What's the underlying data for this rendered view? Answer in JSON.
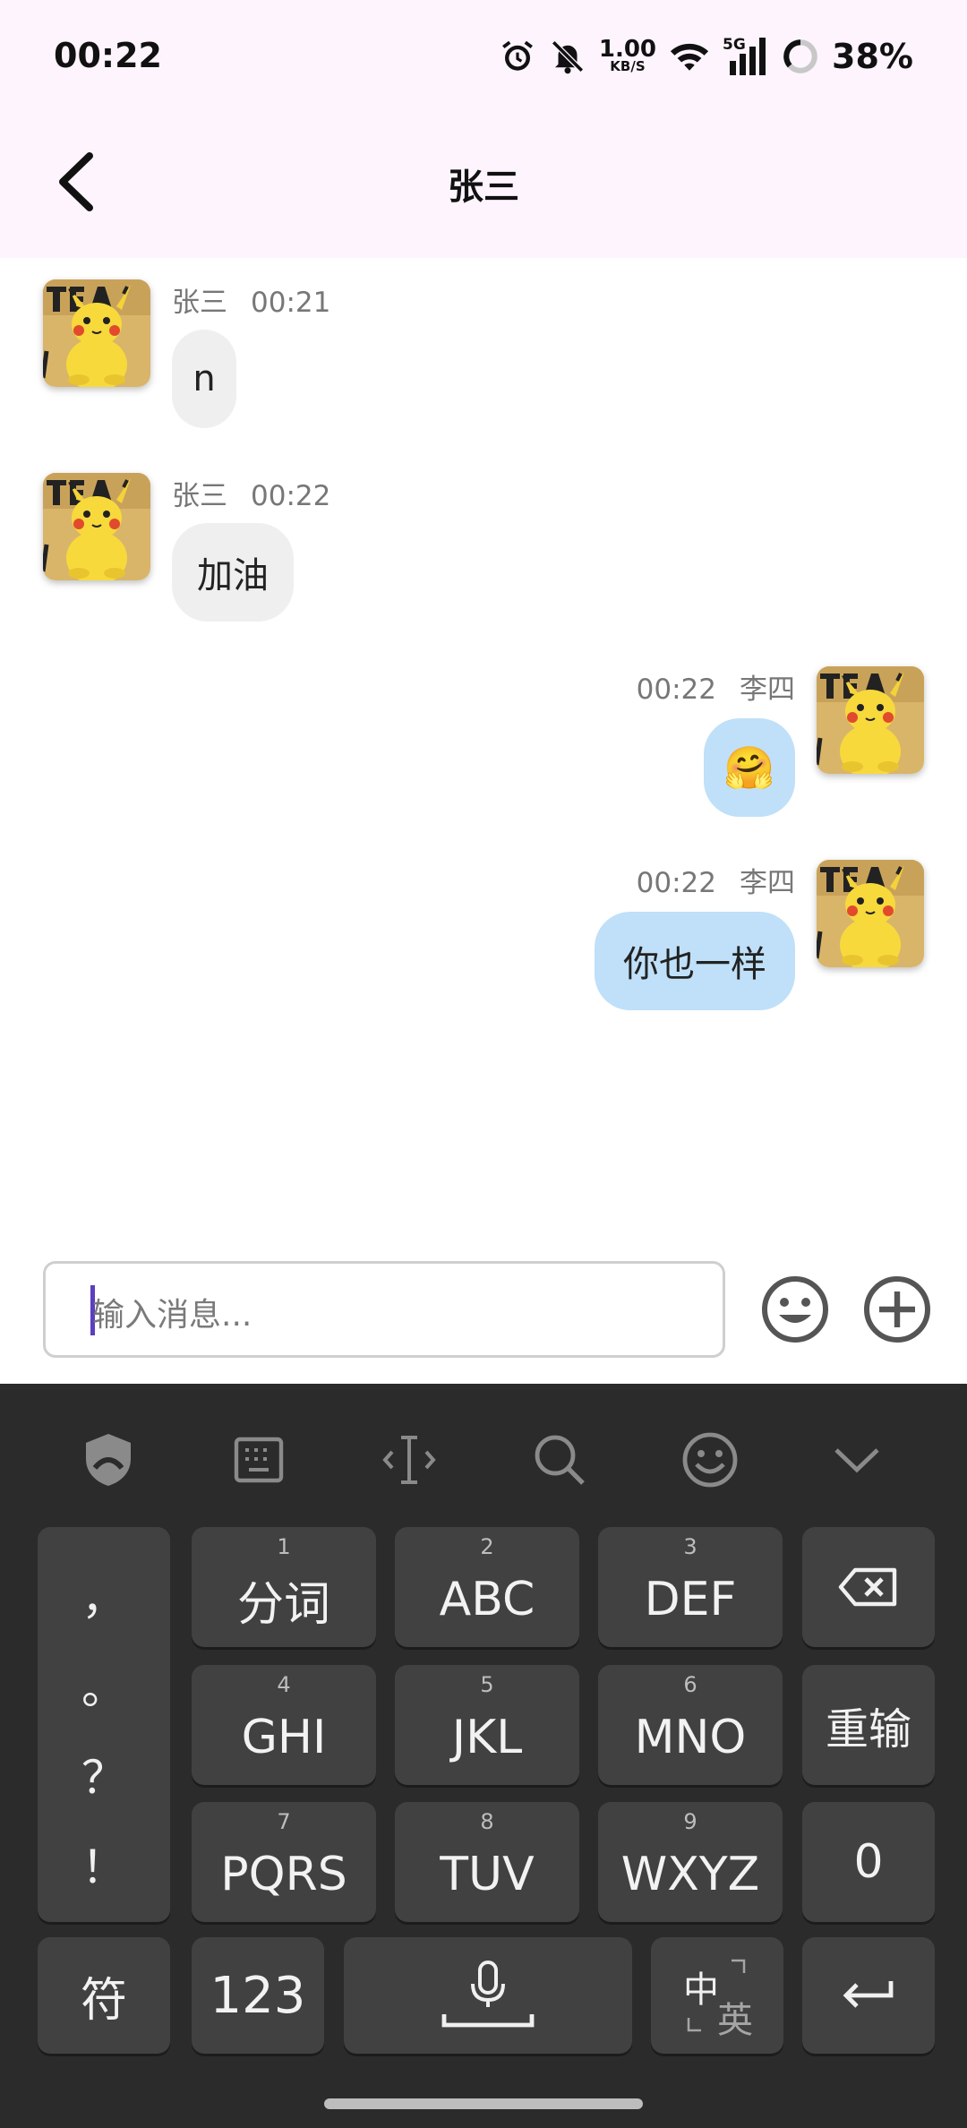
{
  "status": {
    "time": "00:22",
    "speed_value": "1.00",
    "speed_unit": "KB/S",
    "network": "5G",
    "battery": "38%"
  },
  "header": {
    "title": "张三"
  },
  "messages": [
    {
      "side": "left",
      "name": "张三",
      "time": "00:21",
      "text": "n"
    },
    {
      "side": "left",
      "name": "张三",
      "time": "00:22",
      "text": "加油"
    },
    {
      "side": "right",
      "name": "李四",
      "time": "00:22",
      "text": "🤗"
    },
    {
      "side": "right",
      "name": "李四",
      "time": "00:22",
      "text": "你也一样"
    }
  ],
  "composer": {
    "placeholder": "输入消息..."
  },
  "keyboard": {
    "toolbar": [
      "shield-icon",
      "keyboard-icon",
      "cursor-icon",
      "search-icon",
      "emoji-icon",
      "chevron-down-icon"
    ],
    "punctuation": [
      "，",
      "。",
      "？",
      "！"
    ],
    "keys": [
      {
        "num": "1",
        "label": "分词"
      },
      {
        "num": "2",
        "label": "ABC"
      },
      {
        "num": "3",
        "label": "DEF"
      },
      {
        "num": "4",
        "label": "GHI"
      },
      {
        "num": "5",
        "label": "JKL"
      },
      {
        "num": "6",
        "label": "MNO"
      },
      {
        "num": "7",
        "label": "PQRS"
      },
      {
        "num": "8",
        "label": "TUV"
      },
      {
        "num": "9",
        "label": "WXYZ"
      }
    ],
    "reinput": "重输",
    "zero": "0",
    "symbols": "符",
    "numbers": "123",
    "lang_zh": "中",
    "lang_en": "英"
  }
}
